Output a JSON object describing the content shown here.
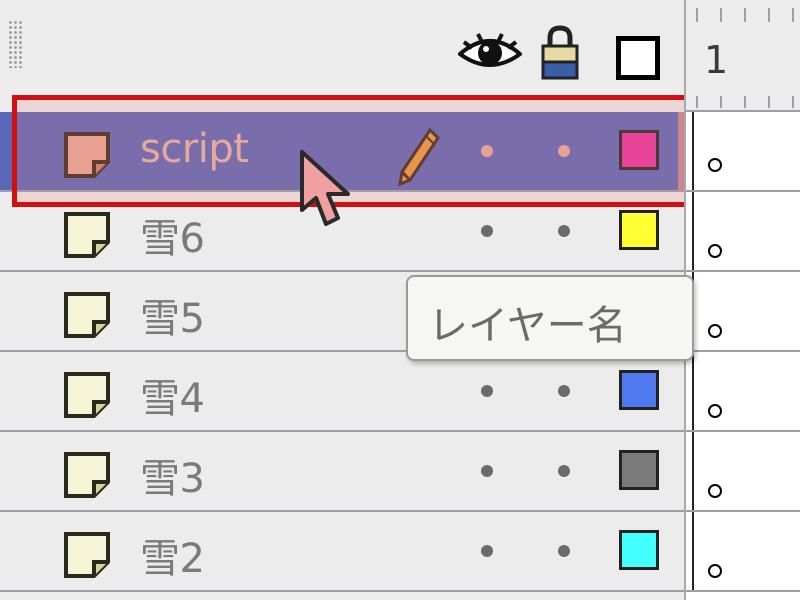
{
  "header": {
    "visibility_icon": "eye-icon",
    "lock_icon": "lock-icon",
    "outline_icon": "outline-square-icon"
  },
  "timeline": {
    "frame_number": "1"
  },
  "layers": [
    {
      "name": "script",
      "selected": true,
      "swatch": "#e8329f",
      "editing": true
    },
    {
      "name": "雪6",
      "selected": false,
      "swatch": "#ffff33"
    },
    {
      "name": "雪5",
      "selected": false,
      "swatch": "#ffffff"
    },
    {
      "name": "雪4",
      "selected": false,
      "swatch": "#4f79ee"
    },
    {
      "name": "雪3",
      "selected": false,
      "swatch": "#7a7a7a"
    },
    {
      "name": "雪2",
      "selected": false,
      "swatch": "#44ffff"
    }
  ],
  "tooltip": {
    "text": "レイヤー名"
  },
  "colors": {
    "selection": "#5a68b7",
    "highlight_border": "#d01010",
    "accent": "#1f8ad8"
  }
}
